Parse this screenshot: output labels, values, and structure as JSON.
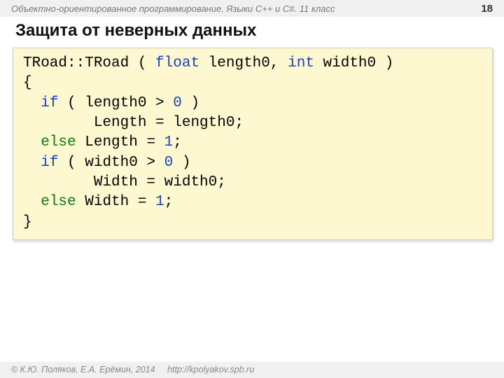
{
  "header": {
    "course": "Объектно-ориентированное программирование. Языки C++ и C#. 11 класс",
    "page_number": "18"
  },
  "title": "Защита от неверных данных",
  "code": {
    "sig_class": "TRoad::TRoad",
    "sig_open": " ( ",
    "kw_float": "float",
    "sig_p1": " length0",
    "sig_comma": ", ",
    "kw_int": "int",
    "sig_p2": " width0 )",
    "brace_open": "{",
    "l1_indent": "  ",
    "kw_if1": "if",
    "l1_cond_a": " ( length0 > ",
    "l1_zero": "0",
    "l1_cond_b": " )",
    "l2_indent": "        Length = length0;",
    "l3_indent": "  ",
    "kw_else1": "else",
    "l3_a": " Length = ",
    "l3_one": "1",
    "l3_b": ";",
    "l4_indent": "  ",
    "kw_if2": "if",
    "l4_cond_a": " ( width0 > ",
    "l4_zero": "0",
    "l4_cond_b": " )",
    "l5_indent": "        Width = width0;",
    "l6_indent": "  ",
    "kw_else2": "else",
    "l6_a": " Width = ",
    "l6_one": "1",
    "l6_b": ";",
    "brace_close": "}"
  },
  "footer": {
    "copyright": "© К.Ю. Поляков, Е.А. Ерёмин, 2014",
    "url": "http://kpolyakov.spb.ru"
  }
}
